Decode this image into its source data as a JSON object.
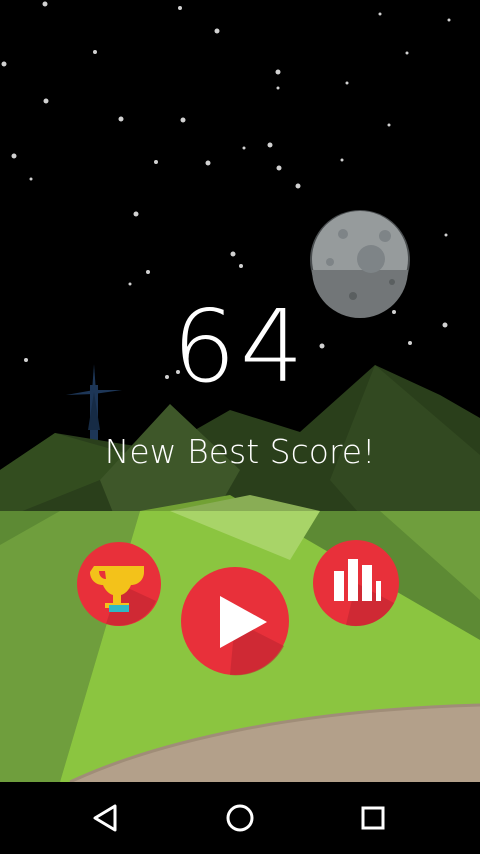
{
  "game": {
    "score": "64",
    "message": "New Best Score!"
  },
  "buttons": {
    "achievements_icon": "trophy-icon",
    "play_icon": "play-icon",
    "leaderboard_icon": "bar-chart-icon"
  },
  "navbar": {
    "back_icon": "back-triangle-icon",
    "home_icon": "home-circle-icon",
    "recents_icon": "recents-square-icon"
  },
  "colors": {
    "sky": "#000000",
    "button_red": "#e8303a",
    "button_shadow": "#b92530",
    "grass": "#8bc540",
    "mountain": "#3a5a2a",
    "path": "#b3a08a"
  }
}
